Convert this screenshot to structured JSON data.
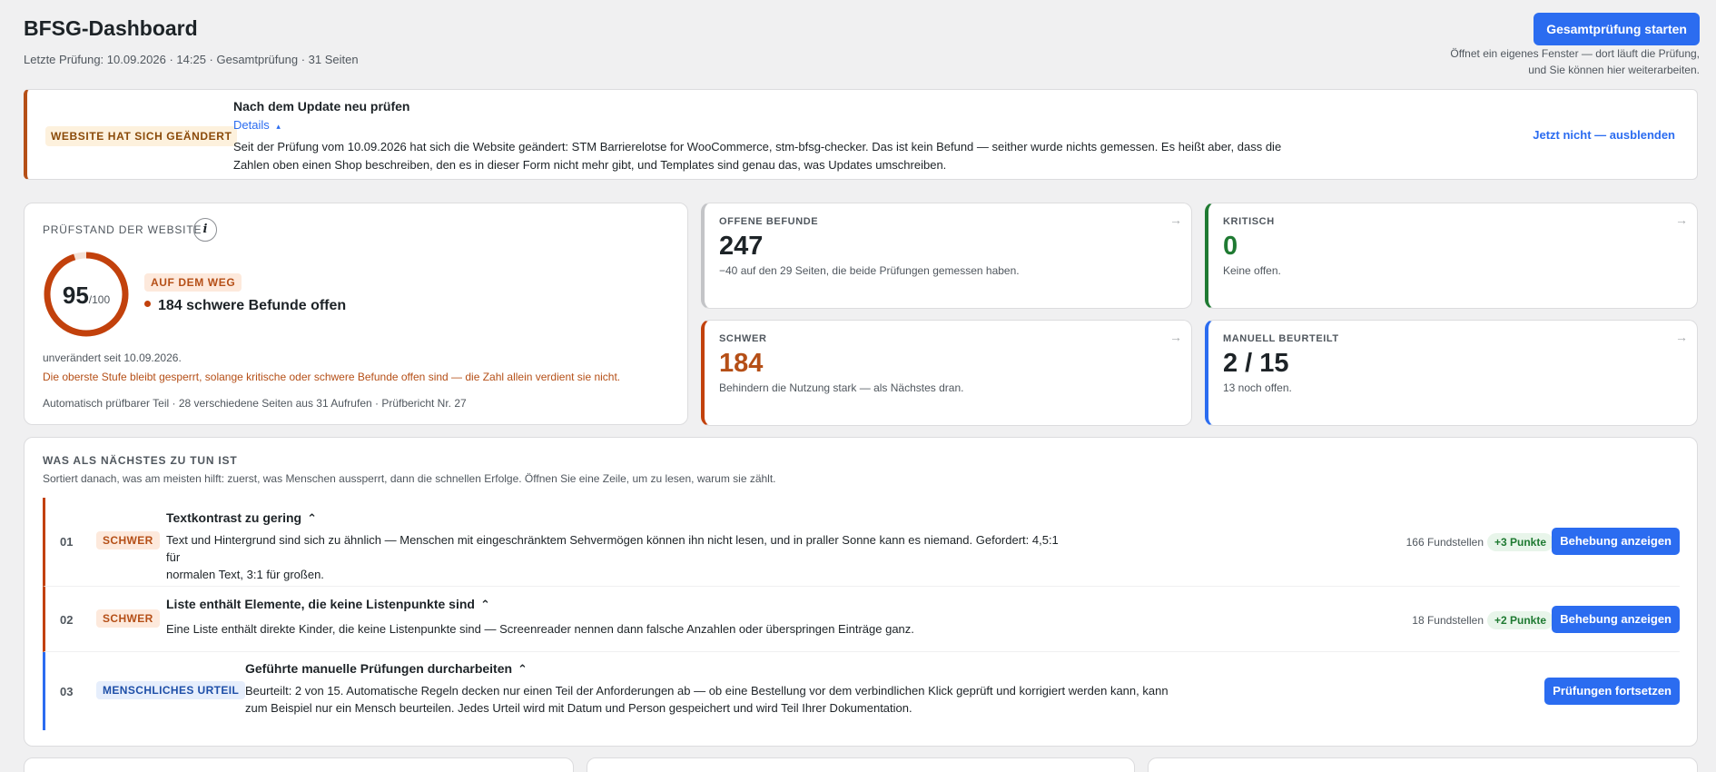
{
  "header": {
    "title": "BFSG-Dashboard",
    "last_check": "Letzte Prüfung: 10.09.2026 · 14:25 · Gesamtprüfung · 31 Seiten",
    "start_button": "Gesamtprüfung starten",
    "start_hint_line1": "Öffnet ein eigenes Fenster — dort läuft die Prüfung,",
    "start_hint_line2": "und Sie können hier weiterarbeiten."
  },
  "notice": {
    "badge": "WEBSITE HAT SICH GEÄNDERT",
    "title": "Nach dem Update neu prüfen",
    "details": "Details",
    "details_chevron": "▴",
    "text": "Seit der Prüfung vom 10.09.2026 hat sich die Website geändert: STM Barrierelotse for WooCommerce, stm-bfsg-checker. Das ist kein Befund — seither wurde nichts gemessen. Es heißt aber, dass die Zahlen oben einen Shop beschreiben, den es in dieser Form nicht mehr gibt, und Templates sind genau das, was Updates umschreiben.",
    "hide": "Jetzt nicht — ausblenden",
    "accent_color": "#b54f17"
  },
  "score": {
    "label": "PRÜFSTAND DER WEBSITE",
    "info_icon": "i",
    "value": "95",
    "max": "/100",
    "fraction": 0.95,
    "status": "AUF DEM WEG",
    "severe_open": "184 schwere Befunde offen",
    "unchanged": "unverändert seit 10.09.2026.",
    "warning": "Die oberste Stufe bleibt gesperrt, solange kritische oder schwere Befunde offen sind — die Zahl allein verdient sie nicht.",
    "auto_part": "Automatisch prüfbarer Teil · 28 verschiedene Seiten aus 31 Aufrufen · Prüfbericht Nr. 27",
    "ring_color": "#c2410c"
  },
  "metrics": {
    "open": {
      "label": "OFFENE BEFUNDE",
      "value": "247",
      "sub": "−40 auf den 29 Seiten, die beide Prüfungen gemessen haben.",
      "color": "#1d2327"
    },
    "critical": {
      "label": "KRITISCH",
      "value": "0",
      "sub": "Keine offen.",
      "color": "#1f7a32"
    },
    "severe": {
      "label": "SCHWER",
      "value": "184",
      "sub": "Behindern die Nutzung stark — als Nächstes dran.",
      "color": "#b54f17"
    },
    "manual": {
      "label": "MANUELL BEURTEILT",
      "value": "2 / 15",
      "sub": "13 noch offen.",
      "color": "#1d2327"
    },
    "arrow": "→"
  },
  "tasks": {
    "title": "WAS ALS NÄCHSTES ZU TUN IST",
    "subtitle": "Sortiert danach, was am meisten hilft: zuerst, was Menschen aussperrt, dann die schnellen Erfolge. Öffnen Sie eine Zeile, um zu lesen, warum sie zählt.",
    "chevron": "⌃",
    "rows": [
      {
        "num": "01",
        "badge": "SCHWER",
        "title": "Textkontrast zu gering",
        "desc_line1": "Text und Hintergrund sind sich zu ähnlich — Menschen mit eingeschränktem Sehvermögen können ihn nicht lesen, und in praller Sonne kann es niemand. Gefordert: 4,5:1 für",
        "desc_line2": "normalen Text, 3:1 für großen.",
        "count": "166 Fundstellen",
        "points": "+3 Punkte",
        "button": "Behebung anzeigen",
        "accent": "#c2410c"
      },
      {
        "num": "02",
        "badge": "SCHWER",
        "title": "Liste enthält Elemente, die keine Listenpunkte sind",
        "desc_line1": "Eine Liste enthält direkte Kinder, die keine Listenpunkte sind — Screenreader nennen dann falsche Anzahlen oder überspringen Einträge ganz.",
        "count": "18 Fundstellen",
        "points": "+2 Punkte",
        "button": "Behebung anzeigen",
        "accent": "#c2410c"
      },
      {
        "num": "03",
        "badge": "MENSCHLICHES URTEIL",
        "title": "Geführte manuelle Prüfungen durcharbeiten",
        "desc_line1": "Beurteilt: 2 von 15. Automatische Regeln decken nur einen Teil der Anforderungen ab — ob eine Bestellung vor dem verbindlichen Klick geprüft und korrigiert werden kann, kann",
        "desc_line2": "zum Beispiel nur ein Mensch beurteilen. Jedes Urteil wird mit Datum und Person gespeichert und wird Teil Ihrer Dokumentation.",
        "button": "Prüfungen fortsetzen",
        "accent": "#2b6cf0"
      }
    ]
  }
}
